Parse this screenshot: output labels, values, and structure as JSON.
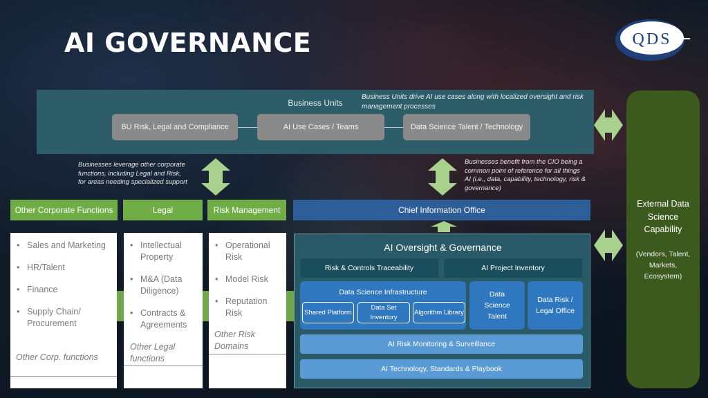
{
  "title": "AI GOVERNANCE",
  "logo": {
    "text": "QDS"
  },
  "business_units": {
    "title": "Business Units",
    "note": "Business Units drive AI use cases along with localized oversight and risk  management processes",
    "items": [
      "BU Risk, Legal and Compliance",
      "AI Use Cases / Teams",
      "Data Science Talent / Technology"
    ]
  },
  "notes": {
    "left": "Businesses leverage other corporate  functions, including Legal and Risk, for  areas needing specialized support",
    "right": "Businesses benefit from the CIO being a  common point of reference for all things AI  (i.e., data, capability, technology, risk &  governance)"
  },
  "columns": [
    {
      "header": "Other Corporate  Functions",
      "items": [
        "Sales and Marketing",
        "HR/Talent",
        "Finance",
        "Supply  Chain/ Procurement"
      ],
      "other": "Other Corp. functions"
    },
    {
      "header": "Legal",
      "items": [
        "Intellectual Property",
        "M&A (Data Diligence)",
        "Contracts & Agreements"
      ],
      "other": "Other Legal functions"
    },
    {
      "header": "Risk Management",
      "items": [
        "Operational Risk",
        "Model Risk",
        "Reputation Risk"
      ],
      "other": "Other Risk Domains"
    }
  ],
  "cio": {
    "header": "Chief Information Office"
  },
  "oversight": {
    "title": "AI Oversight & Governance",
    "traceability": "Risk & Controls Traceability",
    "inventory": "AI Project Inventory",
    "infrastructure": {
      "title": "Data Science Infrastructure",
      "items": [
        "Shared Platform",
        "Data Set Inventory",
        "Algorithm Library"
      ]
    },
    "talent": "Data Science Talent",
    "risk_office": "Data Risk / Legal Office",
    "monitoring": "AI Risk Monitoring & Surveillance",
    "technology": "AI Technology,  Standards & Playbook"
  },
  "external": {
    "title": "External Data Science Capability",
    "subtitle": "(Vendors, Talent, Markets, Ecosystem)"
  },
  "colors": {
    "green": "#70ad47",
    "teal": "#2d5d69",
    "blue": "#2e5e97",
    "dark_green": "#3c5a1e",
    "arrow": "#a9d18e"
  }
}
